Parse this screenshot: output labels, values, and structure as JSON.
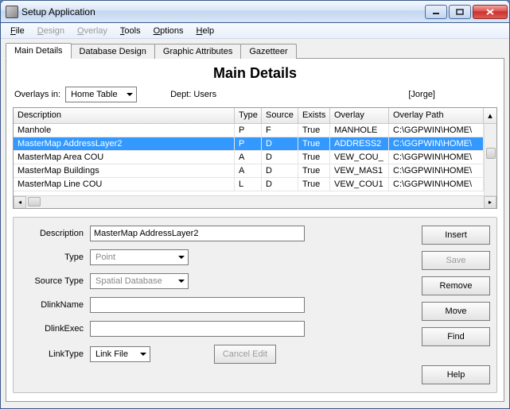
{
  "window": {
    "title": "Setup Application"
  },
  "menubar": [
    "File",
    "Design",
    "Overlay",
    "Tools",
    "Options",
    "Help"
  ],
  "menubar_disabled": [
    false,
    true,
    true,
    false,
    false,
    false
  ],
  "tabs": [
    "Main Details",
    "Database Design",
    "Graphic Attributes",
    "Gazetteer"
  ],
  "active_tab": 0,
  "heading": "Main Details",
  "toprow": {
    "overlays_in_label": "Overlays in:",
    "overlays_in_value": "Home Table",
    "dept_label": "Dept:  Users",
    "user_bracket": "[Jorge]"
  },
  "table": {
    "headers": [
      "Description",
      "Type",
      "Source",
      "Exists",
      "Overlay",
      "Overlay Path"
    ],
    "selected_index": 1,
    "rows": [
      {
        "desc": "Manhole",
        "type": "P",
        "src": "F",
        "exists": "True",
        "ov": "MANHOLE",
        "path": "C:\\GGPWIN\\HOME\\"
      },
      {
        "desc": "MasterMap AddressLayer2",
        "type": "P",
        "src": "D",
        "exists": "True",
        "ov": "ADDRESS2",
        "path": "C:\\GGPWIN\\HOME\\"
      },
      {
        "desc": "MasterMap Area COU",
        "type": "A",
        "src": "D",
        "exists": "True",
        "ov": "VEW_COU_",
        "path": "C:\\GGPWIN\\HOME\\"
      },
      {
        "desc": "MasterMap Buildings",
        "type": "A",
        "src": "D",
        "exists": "True",
        "ov": "VEW_MAS1",
        "path": "C:\\GGPWIN\\HOME\\"
      },
      {
        "desc": "MasterMap Line COU",
        "type": "L",
        "src": "D",
        "exists": "True",
        "ov": "VEW_COU1",
        "path": "C:\\GGPWIN\\HOME\\"
      }
    ]
  },
  "form": {
    "description_label": "Description",
    "description_value": "MasterMap AddressLayer2",
    "type_label": "Type",
    "type_value": "Point",
    "source_type_label": "Source Type",
    "source_type_value": "Spatial Database",
    "dlinkname_label": "DlinkName",
    "dlinkname_value": "",
    "dlinkexec_label": "DlinkExec",
    "dlinkexec_value": "",
    "linktype_label": "LinkType",
    "linktype_value": "Link File",
    "cancel_edit_label": "Cancel Edit"
  },
  "buttons": {
    "insert": "Insert",
    "save": "Save",
    "remove": "Remove",
    "move": "Move",
    "find": "Find",
    "help": "Help"
  }
}
